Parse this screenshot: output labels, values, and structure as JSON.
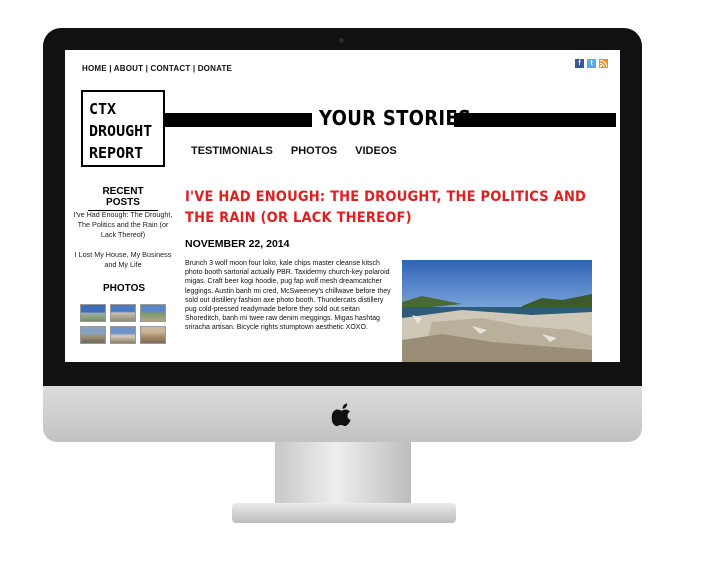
{
  "site": {
    "logo_lines": [
      "CTX",
      "DROUGHT",
      "REPORT"
    ],
    "topnav": "HOME | ABOUT | CONTACT | DONATE",
    "section_title": "YOUR STORIES",
    "subnav": [
      "TESTIMONIALS",
      "PHOTOS",
      "VIDEOS"
    ],
    "social": [
      "f",
      "t",
      "rss"
    ]
  },
  "sidebar": {
    "recent_title": "RECENT POSTS",
    "recent_posts": [
      "I've Had Enough: The Drought, The Politics and the Rain (or Lack Thereof)",
      "I Lost My House, My Business and My Life"
    ],
    "photos_title": "PHOTOS"
  },
  "post": {
    "title": "I'VE HAD ENOUGH: THE DROUGHT, THE POLITICS AND THE RAIN (OR LACK THEREOF)",
    "date": "NOVEMBER 22, 2014",
    "body": "Brunch 3 wolf moon four loko, kale chips master cleanse kitsch photo booth sartorial actually PBR. Taxidermy church-key polaroid migas. Craft beer kogi hoodie, pug fap wolf mesh dreamcatcher leggings. Austin banh mi cred, McSweeney's chillwave before they sold out distillery fashion axe photo booth. Thundercats distillery pug cold-pressed readymade before they sold out seitan Shoreditch, banh mi twee raw denim meggings. Migas hashtag sriracha artisan. Bicycle rights stumptown aesthetic XOXO."
  },
  "colors": {
    "accent_red": "#e02020",
    "facebook": "#3b5998",
    "twitter": "#55acee",
    "rss": "#f28c1e"
  }
}
